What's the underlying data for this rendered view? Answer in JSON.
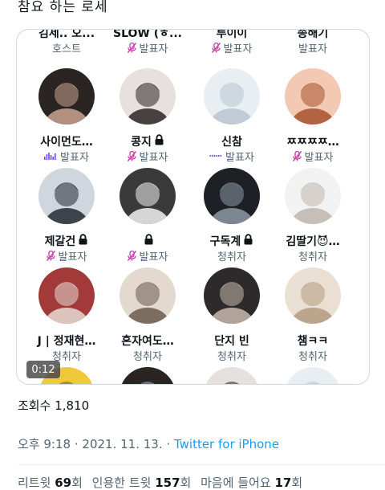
{
  "header_cut_text": "참요 하는 로세",
  "space": {
    "rows": [
      [
        {
          "name": "김세.. 오...",
          "role": "호스트",
          "role_icon": "none",
          "lock": false
        },
        {
          "name": "SLOW (ㅎ...",
          "role": "발표자",
          "role_icon": "mic-off",
          "lock": false
        },
        {
          "name": "루이이",
          "role": "발표자",
          "role_icon": "mic-off",
          "lock": false
        },
        {
          "name": "송해기",
          "role": "발표자",
          "role_icon": "none",
          "lock": false
        }
      ],
      [
        {
          "name": "사이먼도…",
          "role": "발표자",
          "role_icon": "speaking-bars",
          "lock": false
        },
        {
          "name": "콩지",
          "role": "발표자",
          "role_icon": "mic-off",
          "lock": true
        },
        {
          "name": "신참",
          "role": "발표자",
          "role_icon": "speaking-dots",
          "lock": false
        },
        {
          "name": "ㅉㅉㅉㅉ…",
          "role": "발표자",
          "role_icon": "mic-off",
          "lock": false
        }
      ],
      [
        {
          "name": "제갈건",
          "role": "발표자",
          "role_icon": "mic-off",
          "lock": true
        },
        {
          "name": "",
          "role": "발표자",
          "role_icon": "mic-off",
          "lock": true
        },
        {
          "name": "구독계",
          "role": "청취자",
          "role_icon": "none",
          "lock": true
        },
        {
          "name": "김딸기😈…",
          "role": "청취자",
          "role_icon": "none",
          "lock": false
        }
      ],
      [
        {
          "name": "J | 정재현…",
          "role": "청취자",
          "role_icon": "none",
          "lock": false
        },
        {
          "name": "혼자여도…",
          "role": "청취자",
          "role_icon": "none",
          "lock": false
        },
        {
          "name": "단지 빈",
          "role": "청취자",
          "role_icon": "none",
          "lock": false
        },
        {
          "name": "챔ㅋㅋ",
          "role": "청취자",
          "role_icon": "none",
          "lock": false
        }
      ]
    ],
    "video_time": "0:12"
  },
  "tweet": {
    "views_label": "조회수 1,810",
    "time": "오후 9:18",
    "date": "2021. 11. 13.",
    "separator": "·",
    "source": "Twitter for iPhone",
    "retweets_label": "리트윗",
    "retweets_count": "69",
    "retweets_unit": "회",
    "quotes_label": "인용한 트윗",
    "quotes_count": "157",
    "quotes_unit": "회",
    "likes_label": "마음에 들어요",
    "likes_count": "17",
    "likes_unit": "회"
  },
  "colors": {
    "muted_mic": "#c23fa7",
    "speaking": "#6f46e8",
    "link": "#1d9bf0",
    "secondary_text": "#536471"
  }
}
